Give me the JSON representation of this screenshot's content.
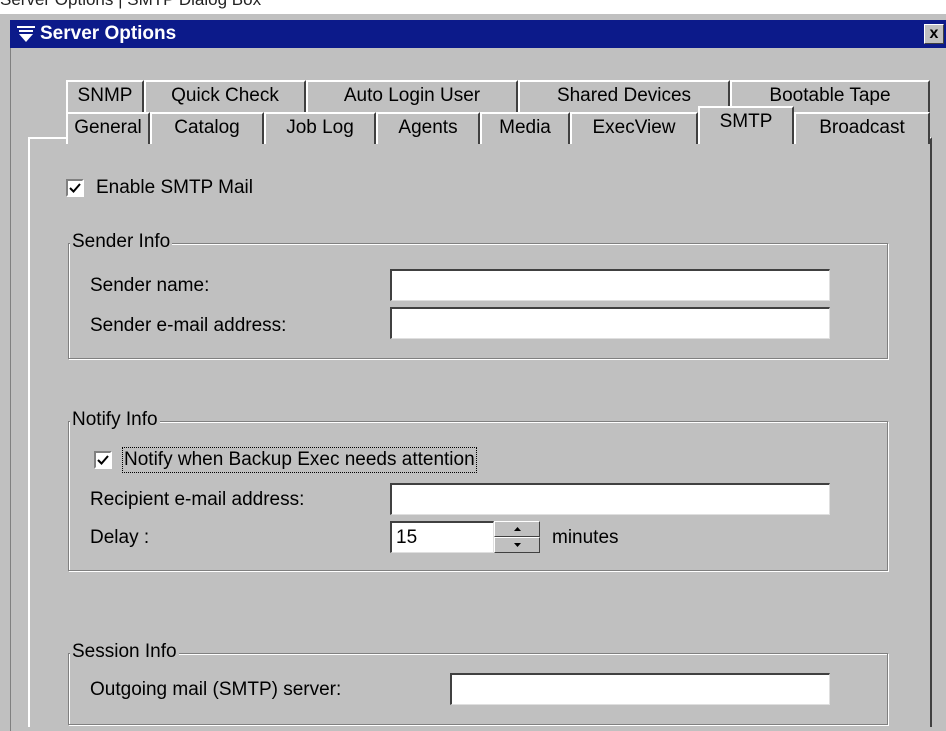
{
  "caption": "Server Options | SMTP Dialog Box",
  "window": {
    "title": "Server Options",
    "close_label": "x"
  },
  "tabs_row1": [
    {
      "label": "SNMP"
    },
    {
      "label": "Quick Check"
    },
    {
      "label": "Auto Login User"
    },
    {
      "label": "Shared Devices"
    },
    {
      "label": "Bootable Tape"
    }
  ],
  "tabs_row2": [
    {
      "label": "General"
    },
    {
      "label": "Catalog"
    },
    {
      "label": "Job Log"
    },
    {
      "label": "Agents"
    },
    {
      "label": "Media"
    },
    {
      "label": "ExecView"
    },
    {
      "label": "SMTP",
      "active": true
    },
    {
      "label": "Broadcast"
    }
  ],
  "enable_smtp": {
    "label": "Enable SMTP Mail",
    "checked": true
  },
  "sender_info": {
    "legend": "Sender Info",
    "name_label": "Sender name:",
    "name_value": "",
    "email_label": "Sender e-mail address:",
    "email_value": ""
  },
  "notify_info": {
    "legend": "Notify Info",
    "notify_label": "Notify when Backup Exec needs attention",
    "notify_checked": true,
    "recipient_label": "Recipient e-mail address:",
    "recipient_value": "",
    "delay_label": "Delay :",
    "delay_value": "15",
    "delay_unit": "minutes"
  },
  "session_info": {
    "legend": "Session Info",
    "server_label": "Outgoing mail (SMTP) server:",
    "server_value": ""
  },
  "colors": {
    "titlebar": "#0c1a8a",
    "dialog_face": "#c0c0c0"
  }
}
